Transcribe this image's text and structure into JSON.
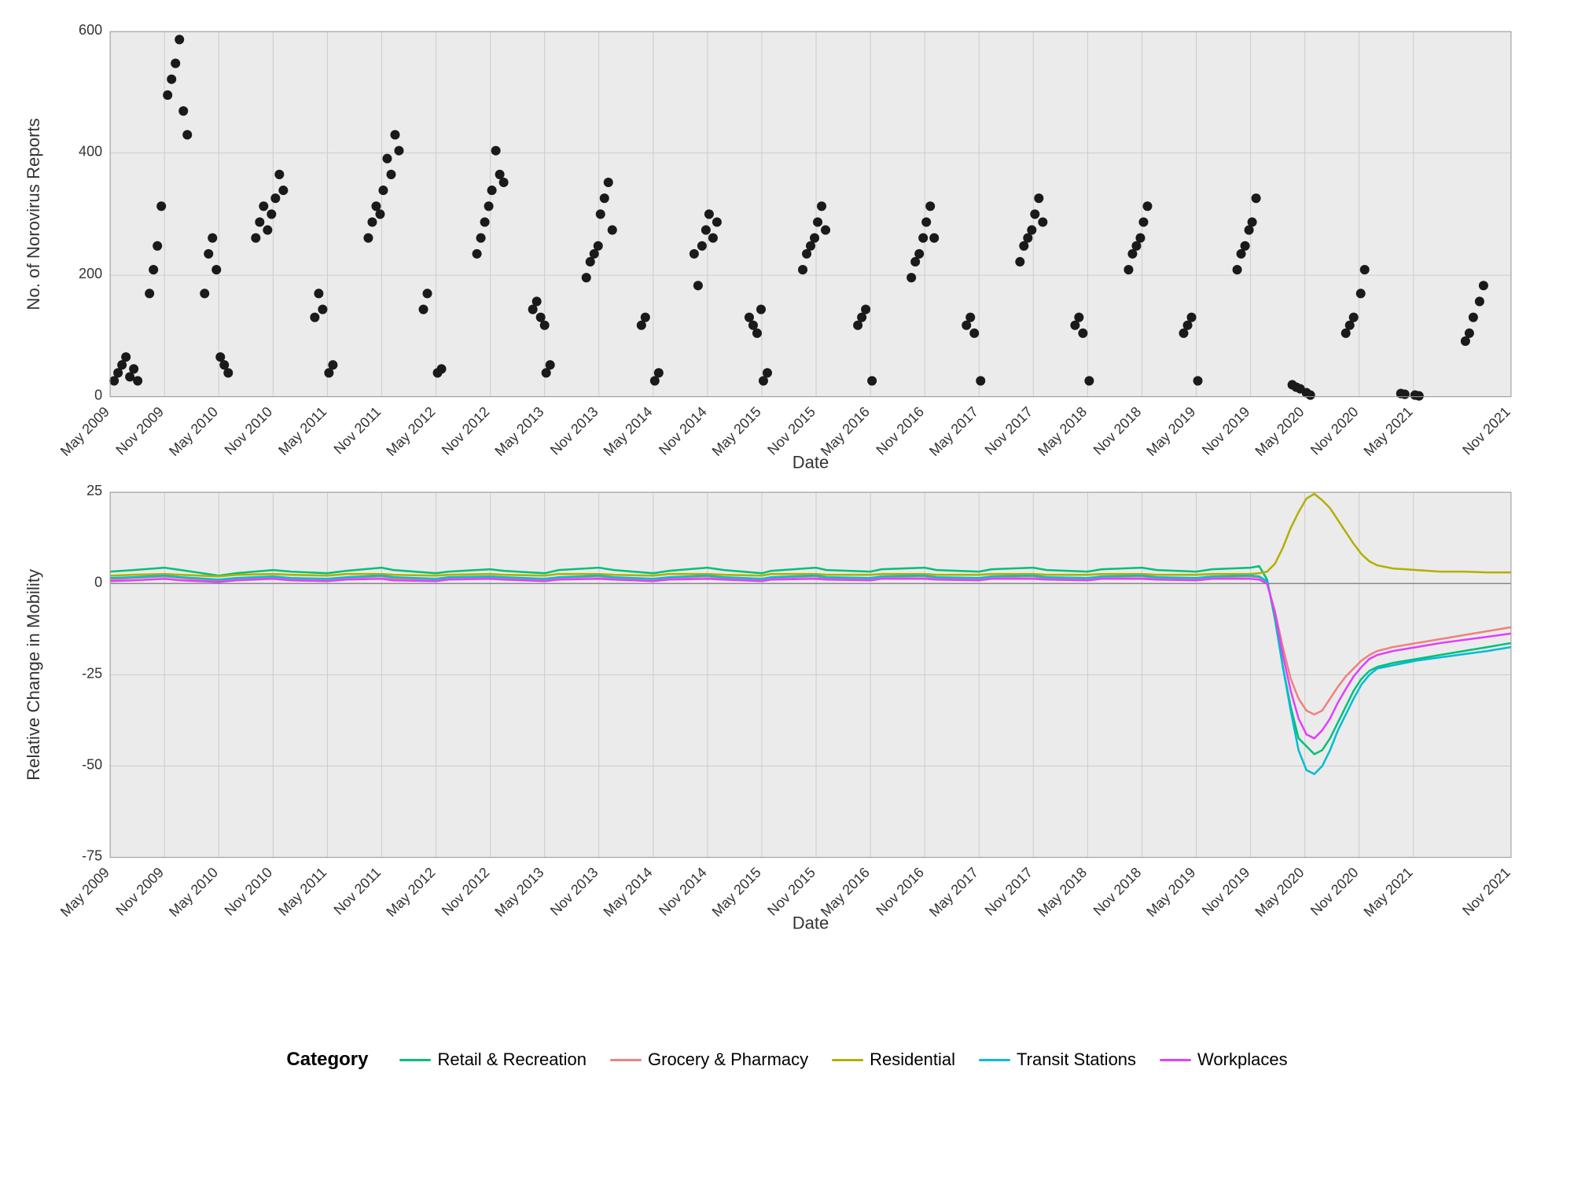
{
  "charts": {
    "top": {
      "title": "No. of Norovirus Reports",
      "x_label": "Date",
      "y_axis": [
        0,
        200,
        400,
        600
      ],
      "x_ticks": [
        "May 2009",
        "Nov 2009",
        "May 2010",
        "Nov 2010",
        "May 2011",
        "Nov 2011",
        "May 2012",
        "Nov 2012",
        "May 2013",
        "Nov 2013",
        "May 2014",
        "Nov 2014",
        "May 2015",
        "Nov 2015",
        "May 2016",
        "Nov 2016",
        "May 2017",
        "Nov 2017",
        "May 2018",
        "Nov 2018",
        "May 2019",
        "Nov 2019",
        "May 2020",
        "Nov 2020",
        "May 2021",
        "Nov 2021"
      ]
    },
    "bottom": {
      "title": "Relative Change in Mobility",
      "x_label": "Date",
      "y_axis": [
        -75,
        -50,
        -25,
        0,
        25
      ],
      "x_ticks": [
        "May 2009",
        "Nov 2009",
        "May 2010",
        "Nov 2010",
        "May 2011",
        "Nov 2011",
        "May 2012",
        "Nov 2012",
        "May 2013",
        "Nov 2013",
        "May 2014",
        "Nov 2014",
        "May 2015",
        "Nov 2015",
        "May 2016",
        "Nov 2016",
        "May 2017",
        "Nov 2017",
        "May 2018",
        "Nov 2018",
        "May 2019",
        "Nov 2019",
        "May 2020",
        "Nov 2020",
        "May 2021",
        "Nov 2021"
      ]
    },
    "legend": {
      "title": "Category",
      "items": [
        {
          "label": "Retail & Recreation",
          "color": "#00c078"
        },
        {
          "label": "Grocery & Pharmacy",
          "color": "#f08080"
        },
        {
          "label": "Residential",
          "color": "#b0b000"
        },
        {
          "label": "Transit Stations",
          "color": "#00bcd4"
        },
        {
          "label": "Workplaces",
          "color": "#e040fb"
        }
      ]
    }
  }
}
